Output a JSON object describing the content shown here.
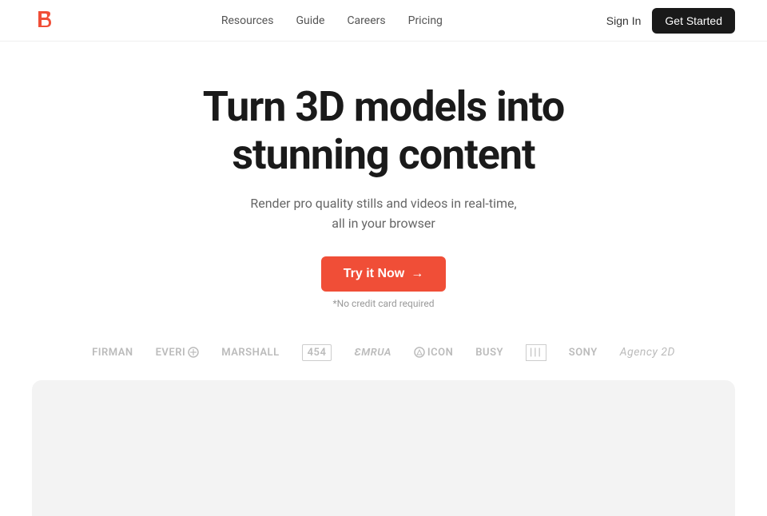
{
  "nav": {
    "links": [
      {
        "label": "Resources",
        "id": "resources"
      },
      {
        "label": "Guide",
        "id": "guide"
      },
      {
        "label": "Careers",
        "id": "careers"
      },
      {
        "label": "Pricing",
        "id": "pricing"
      }
    ],
    "sign_in_label": "Sign In",
    "get_started_label": "Get Started"
  },
  "hero": {
    "title_line1": "Turn 3D models into",
    "title_line2": "stunning content",
    "subtitle_line1": "Render pro quality stills and videos in real-time,",
    "subtitle_line2": "all in your browser",
    "cta_label": "Try it Now",
    "cta_arrow": "→",
    "no_cc_label": "*No credit card required"
  },
  "logos": [
    {
      "label": "FIRMAN",
      "style": "normal"
    },
    {
      "label": "EVERI ⊕",
      "style": "normal"
    },
    {
      "label": "Marshall",
      "style": "normal"
    },
    {
      "label": "454",
      "style": "bordered"
    },
    {
      "label": "EMRUA",
      "style": "normal"
    },
    {
      "label": "⊕ ICON",
      "style": "normal"
    },
    {
      "label": "BUSY",
      "style": "normal"
    },
    {
      "label": "|||",
      "style": "bordered"
    },
    {
      "label": "SONY",
      "style": "normal"
    },
    {
      "label": "Agency 2D",
      "style": "italic"
    }
  ],
  "colors": {
    "cta_bg": "#f04e37",
    "dark_btn_bg": "#1a1a1a",
    "preview_bg": "#f3f3f3"
  }
}
